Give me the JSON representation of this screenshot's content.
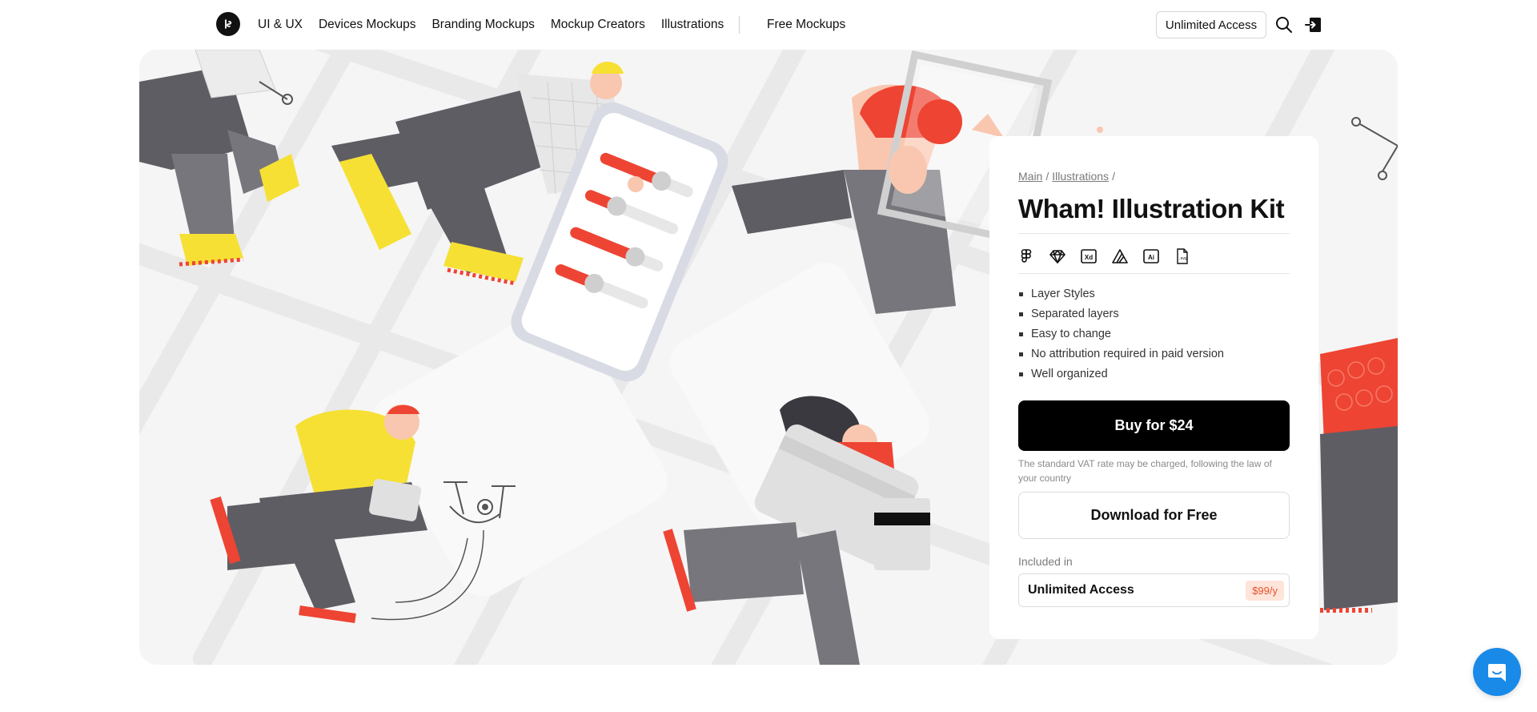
{
  "header": {
    "logo_icon": "studio-logo-icon",
    "nav": [
      {
        "label": "UI & UX"
      },
      {
        "label": "Devices Mockups"
      },
      {
        "label": "Branding Mockups"
      },
      {
        "label": "Mockup Creators"
      },
      {
        "label": "Illustrations"
      }
    ],
    "free_label": "Free Mockups",
    "unlimited_label": "Unlimited Access",
    "search_icon": "search-icon",
    "login_icon": "login-icon"
  },
  "hero": {
    "illustration": "wham-illustration-scene"
  },
  "card": {
    "breadcrumb": [
      {
        "label": "Main"
      },
      {
        "label": "Illustrations"
      }
    ],
    "title": "Wham! Illustration Kit",
    "formats": [
      "figma-icon",
      "sketch-icon",
      "xd-icon",
      "affinity-icon",
      "illustrator-icon",
      "svg-file-icon"
    ],
    "features": [
      "Layer Styles",
      "Separated layers",
      "Easy to change",
      "No attribution required in paid version",
      "Well organized"
    ],
    "buy_label": "Buy for $24",
    "vat_note": "The standard VAT rate may be charged, following the law of your country",
    "download_label": "Download for Free",
    "included_label": "Included in",
    "unlimited": {
      "label": "Unlimited Access",
      "price": "$99/y"
    }
  },
  "chat": {
    "icon": "chat-icon"
  },
  "colors": {
    "accent_red": "#ee4433",
    "accent_yellow": "#f6e034",
    "dark": "#000000",
    "badge_bg": "#ffe4d9",
    "badge_text": "#e8502a",
    "chat_blue": "#1a8ae8"
  }
}
